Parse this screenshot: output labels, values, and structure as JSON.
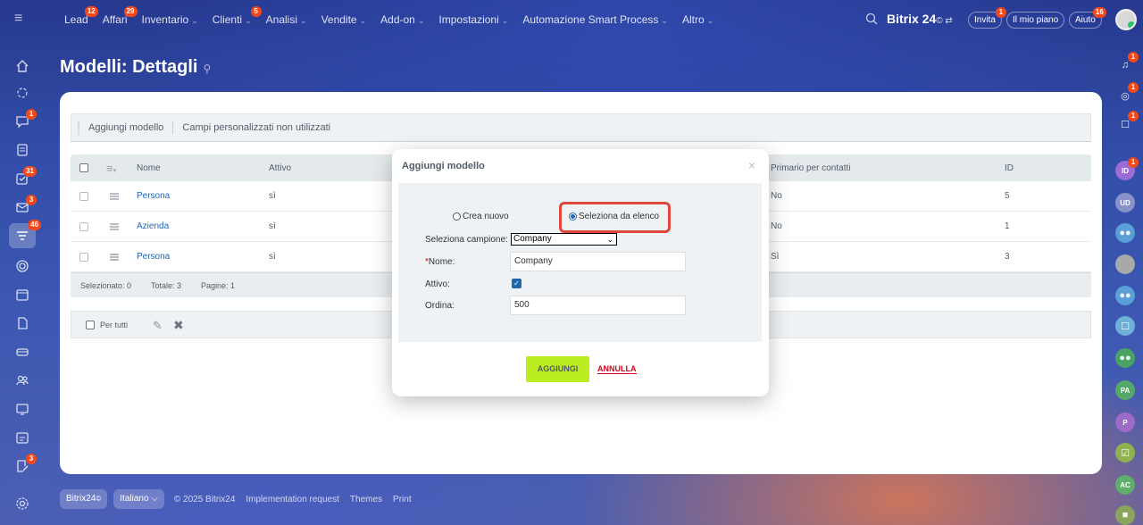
{
  "topbar": {
    "nav": [
      {
        "label": "Lead",
        "badge": "12",
        "chevron": false
      },
      {
        "label": "Affari",
        "badge": "29",
        "chevron": false
      },
      {
        "label": "Inventario",
        "badge": "",
        "chevron": true
      },
      {
        "label": "Clienti",
        "badge": "5",
        "chevron": true
      },
      {
        "label": "Analisi",
        "badge": "",
        "chevron": true
      },
      {
        "label": "Vendite",
        "badge": "",
        "chevron": true
      },
      {
        "label": "Add-on",
        "badge": "",
        "chevron": true
      },
      {
        "label": "Impostazioni",
        "badge": "",
        "chevron": true
      },
      {
        "label": "Automazione Smart Process",
        "badge": "",
        "chevron": true
      },
      {
        "label": "Altro",
        "badge": "",
        "chevron": true
      }
    ],
    "brand": "Bitrix 24",
    "brand_mark": "©",
    "invite_label": "Invita",
    "invite_badge": "1",
    "plan_label": "Il mio piano",
    "help_label": "Aiuto",
    "help_badge": "16"
  },
  "left_sidebar": {
    "badges": {
      "chat": "1",
      "tasks": "31",
      "mail": "3",
      "crm": "46",
      "last": "3"
    }
  },
  "right_sidebar": {
    "items": [
      {
        "icon": "bell-icon",
        "badge": "1",
        "color": "transparent",
        "text": ""
      },
      {
        "icon": "target-icon",
        "badge": "1",
        "color": "transparent",
        "text": ""
      },
      {
        "icon": "chat-icon",
        "badge": "1",
        "color": "transparent",
        "text": ""
      },
      {
        "icon": "avatar",
        "badge": "1",
        "color": "#9b6bd6",
        "text": "ID"
      },
      {
        "icon": "avatar",
        "badge": "",
        "color": "#8a93c9",
        "text": "UD"
      },
      {
        "icon": "group-icon",
        "badge": "",
        "color": "#5aa0d6",
        "text": ""
      },
      {
        "icon": "avatar",
        "badge": "",
        "color": "#a9a9a9",
        "text": ""
      },
      {
        "icon": "group-icon",
        "badge": "",
        "color": "#5aa0d6",
        "text": ""
      },
      {
        "icon": "chat-icon",
        "badge": "",
        "color": "#6fb0d8",
        "text": ""
      },
      {
        "icon": "group-icon",
        "badge": "",
        "color": "#4ba363",
        "text": ""
      },
      {
        "icon": "avatar",
        "badge": "",
        "color": "#55a86a",
        "text": "PA"
      },
      {
        "icon": "avatar",
        "badge": "",
        "color": "#9c6ac9",
        "text": "P"
      },
      {
        "icon": "task-icon",
        "badge": "",
        "color": "#8fb24f",
        "text": ""
      },
      {
        "icon": "avatar",
        "badge": "",
        "color": "#5fae6c",
        "text": "AC"
      },
      {
        "icon": "video-icon",
        "badge": "",
        "color": "#8aa45c",
        "text": ""
      }
    ]
  },
  "page": {
    "title": "Modelli: Dettagli",
    "toolbar": {
      "add_model": "Aggiungi modello",
      "unused_fields": "Campi personalizzati non utilizzati"
    },
    "grid": {
      "columns": {
        "name": "Nome",
        "active": "Attivo",
        "primary": "Primario per contatti",
        "id": "ID"
      },
      "rows": [
        {
          "name": "Persona",
          "active": "sì",
          "primary": "No",
          "id": "5"
        },
        {
          "name": "Azienda",
          "active": "sì",
          "primary": "No",
          "id": "1"
        },
        {
          "name": "Persona",
          "active": "sì",
          "primary": "Sì",
          "id": "3"
        }
      ],
      "footer": {
        "selected": "Selezionato: 0",
        "total": "Totale: 3",
        "pages": "Pagine:  1"
      }
    },
    "actions": {
      "for_all": "Per tutti"
    }
  },
  "footer": {
    "brand": "Bitrix24",
    "language": "Italiano",
    "copyright": "© 2025 Bitrix24",
    "implementation": "Implementation request",
    "themes": "Themes",
    "print": "Print"
  },
  "modal": {
    "title": "Aggiungi modello",
    "radio_new": "Crea nuovo",
    "radio_list": "Seleziona da elenco",
    "select_sample_label": "Seleziona campione:",
    "select_sample_value": "Company",
    "name_label": "Nome:",
    "name_value": "Company",
    "active_label": "Attivo:",
    "order_label": "Ordina:",
    "order_value": "500",
    "add_button": "AGGIUNGI",
    "cancel_button": "ANNULLA"
  },
  "colors": {
    "accent_blue": "#2067b0",
    "add_button": "#bbed21",
    "highlight": "#e0473c",
    "badge": "#f54819"
  }
}
